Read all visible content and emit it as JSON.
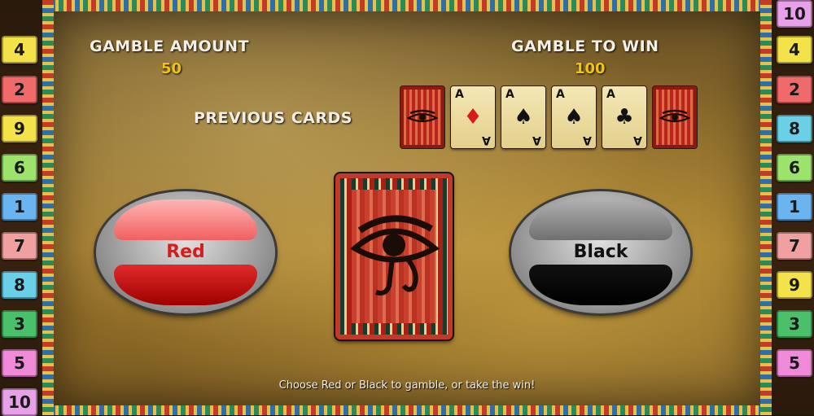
{
  "header": {
    "gamble_amount_label": "GAMBLE AMOUNT",
    "gamble_amount_value": "50",
    "gamble_to_win_label": "GAMBLE TO WIN",
    "gamble_to_win_value": "100",
    "previous_cards_label": "PREVIOUS CARDS"
  },
  "previous_cards": [
    {
      "type": "back",
      "icon": "eye-of-horus-icon"
    },
    {
      "type": "face",
      "rank": "A",
      "suit": "♦",
      "color": "#d81b1b",
      "icon": "diamond-suit-icon"
    },
    {
      "type": "face",
      "rank": "A",
      "suit": "♠",
      "color": "#111111",
      "icon": "spade-suit-icon"
    },
    {
      "type": "face",
      "rank": "A",
      "suit": "♠",
      "color": "#111111",
      "icon": "spade-suit-icon"
    },
    {
      "type": "face",
      "rank": "A",
      "suit": "♣",
      "color": "#111111",
      "icon": "club-suit-icon"
    },
    {
      "type": "back",
      "icon": "eye-of-horus-icon"
    }
  ],
  "current_card": {
    "type": "back",
    "icon": "eye-of-horus-icon"
  },
  "buttons": {
    "red_label": "Red",
    "black_label": "Black"
  },
  "message": "Choose Red or Black to gamble, or take the win!",
  "lines_left": [
    {
      "n": "4",
      "color": "#f4e24a"
    },
    {
      "n": "2",
      "color": "#f06a6a"
    },
    {
      "n": "9",
      "color": "#f4e24a"
    },
    {
      "n": "6",
      "color": "#9be36a"
    },
    {
      "n": "1",
      "color": "#6ab4f0"
    },
    {
      "n": "7",
      "color": "#f0a0a0"
    },
    {
      "n": "8",
      "color": "#6ad0e8"
    },
    {
      "n": "3",
      "color": "#4ac06a"
    },
    {
      "n": "5",
      "color": "#f08ad8"
    },
    {
      "n": "10",
      "color": "#e8a0e8"
    }
  ],
  "lines_right": [
    {
      "n": "10",
      "color": "#e8a0e8"
    },
    {
      "n": "4",
      "color": "#f4e24a"
    },
    {
      "n": "2",
      "color": "#f06a6a"
    },
    {
      "n": "8",
      "color": "#6ad0e8"
    },
    {
      "n": "6",
      "color": "#9be36a"
    },
    {
      "n": "1",
      "color": "#6ab4f0"
    },
    {
      "n": "7",
      "color": "#f0a0a0"
    },
    {
      "n": "9",
      "color": "#f4e24a"
    },
    {
      "n": "3",
      "color": "#4ac06a"
    },
    {
      "n": "5",
      "color": "#f08ad8"
    }
  ]
}
